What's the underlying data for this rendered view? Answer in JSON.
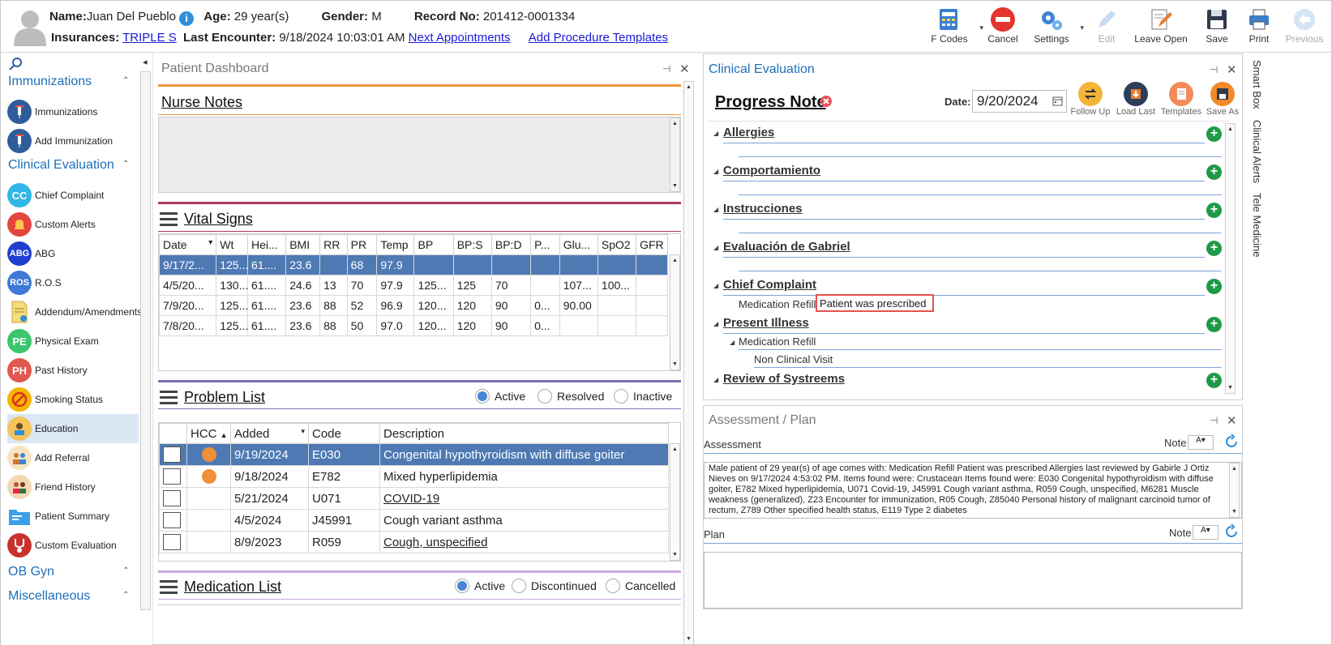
{
  "header": {
    "name_label": "Name:",
    "name_value": "Juan Del Pueblo",
    "info_glyph": "i",
    "age_label": "Age:",
    "age_value": "29 year(s)",
    "gender_label": "Gender:",
    "gender_value": "M",
    "record_label": "Record No:",
    "record_value": "201412-0001334",
    "insurances_label": "Insurances:",
    "insurance_link": "TRIPLE S",
    "last_encounter_label": "Last Encounter:",
    "last_encounter_value": "9/18/2024 10:03:01 AM",
    "next_appointments": "Next Appointments",
    "add_procedure_templates": "Add Procedure Templates"
  },
  "toolbar": {
    "fcodes": "F Codes",
    "cancel": "Cancel",
    "settings": "Settings",
    "edit": "Edit",
    "leave_open": "Leave Open",
    "save": "Save",
    "print": "Print",
    "previous": "Previous",
    "dropdown_glyph": "▾"
  },
  "sidebar": {
    "collapse_glyph": "◂",
    "chevron_up": "⌃",
    "sections": {
      "immunizations": "Immunizations",
      "clinical_evaluation": "Clinical Evaluation",
      "ob_gyn": "OB Gyn",
      "miscellaneous": "Miscellaneous"
    },
    "items": {
      "immunizations": "Immunizations",
      "add_immunization": "Add Immunization",
      "chief_complaint": "Chief Complaint",
      "custom_alerts": "Custom Alerts",
      "abg": "ABG",
      "ros": "R.O.S",
      "addendum": "Addendum/Amendments",
      "physical_exam": "Physical Exam",
      "past_history": "Past History",
      "smoking_status": "Smoking Status",
      "education": "Education",
      "add_referral": "Add Referral",
      "friend_history": "Friend History",
      "patient_summary": "Patient Summary",
      "custom_evaluation": "Custom Evaluation"
    },
    "icon_text": {
      "cc": "CC",
      "abg": "ABG",
      "ros": "ROS",
      "pe": "PE",
      "ph": "PH"
    }
  },
  "dashboard": {
    "title": "Patient Dashboard",
    "pin_glyph": "⊣",
    "close_glyph": "✕",
    "nurse_notes_title": "Nurse Notes",
    "vital_signs_title": "Vital Signs",
    "vitals_columns": [
      "Date",
      "Wt",
      "Hei...",
      "BMI",
      "RR",
      "PR",
      "Temp",
      "BP",
      "BP:S",
      "BP:D",
      "P...",
      "Glu...",
      "SpO2",
      "GFR"
    ],
    "vitals_sort_glyph": "▾",
    "vitals_rows": [
      [
        "9/17/2...",
        "125...",
        "61....",
        "23.6",
        "",
        "68",
        "97.9",
        "",
        "",
        "",
        "",
        "",
        "",
        ""
      ],
      [
        "4/5/20...",
        "130...",
        "61....",
        "24.6",
        "13",
        "70",
        "97.9",
        "125...",
        "125",
        "70",
        "",
        "107...",
        "100...",
        ""
      ],
      [
        "7/9/20...",
        "125...",
        "61....",
        "23.6",
        "88",
        "52",
        "96.9",
        "120...",
        "120",
        "90",
        "0...",
        "90.00",
        "",
        ""
      ],
      [
        "7/8/20...",
        "125...",
        "61....",
        "23.6",
        "88",
        "50",
        "97.0",
        "120...",
        "120",
        "90",
        "0...",
        "",
        "",
        ""
      ]
    ],
    "problem_list_title": "Problem List",
    "problem_filters": {
      "active": "Active",
      "resolved": "Resolved",
      "inactive": "Inactive"
    },
    "problem_columns": {
      "hcc": "HCC",
      "added": "Added",
      "code": "Code",
      "description": "Description"
    },
    "problem_rows": [
      {
        "hcc": true,
        "added": "9/19/2024",
        "code": "E030",
        "description": "Congenital hypothyroidism with diffuse goiter",
        "link": false
      },
      {
        "hcc": true,
        "added": "9/18/2024",
        "code": "E782",
        "description": "Mixed hyperlipidemia",
        "link": false
      },
      {
        "hcc": false,
        "added": "5/21/2024",
        "code": "U071",
        "description": "COVID-19",
        "link": true
      },
      {
        "hcc": false,
        "added": "4/5/2024",
        "code": "J45991",
        "description": "Cough variant asthma",
        "link": false
      },
      {
        "hcc": false,
        "added": "8/9/2023",
        "code": "R059",
        "description": "Cough, unspecified",
        "link": true
      }
    ],
    "medication_list_title": "Medication List",
    "medication_filters": {
      "active": "Active",
      "discontinued": "Discontinued",
      "cancelled": "Cancelled"
    }
  },
  "clinical_evaluation": {
    "title": "Clinical Evaluation",
    "note_title": "Progress Note",
    "date_label": "Date:",
    "date_value": "9/20/2024",
    "actions": {
      "follow_up": "Follow Up",
      "load_last": "Load Last",
      "templates": "Templates",
      "save_as": "Save As"
    },
    "sections": {
      "allergies": "Allergies",
      "comportamiento": "Comportamiento",
      "instrucciones": "Instrucciones",
      "evaluacion": "Evaluación de Gabriel",
      "chief_complaint": "Chief Complaint",
      "present_illness": "Present Illness",
      "review_of_systems": "Review of Systreems"
    },
    "chief_complaint_label": "Medication Refill",
    "chief_complaint_value": "Patient was prescribed",
    "present_illness_item": "Medication Refill",
    "present_illness_sub": "Non Clinical Visit",
    "expand_glyph": "◢",
    "plus_glyph": "+"
  },
  "assessment_plan": {
    "title": "Assessment / Plan",
    "assessment_label": "Assessment",
    "note_label": "Note",
    "assessment_text": "Male patient of 29 year(s) of age comes with: Medication Refill Patient was prescribed     Allergies last reviewed by Gabirle J Ortiz Nieves on 9/17/2024 4:53:02 PM.    Items found were:  Crustacean  Items found were:  E030 Congenital hypothyroidism with diffuse goiter, E782 Mixed hyperlipidemia, U071 Covid-19, J45991 Cough variant asthma, R059 Cough, unspecified, M6281 Muscle weakness (generalized), Z23 Encounter for immunization, R05 Cough, Z85040 Personal history of malignant carcinoid tumor of rectum, Z789 Other specified health status, E119 Type 2 diabetes",
    "plan_label": "Plan"
  },
  "right_tabs": {
    "smart_box": "Smart Box",
    "clinical_alerts": "Clinical Alerts",
    "tele_medicine": "Tele Medicine"
  },
  "colors": {
    "accent_blue": "#1f6fb8",
    "orange_divider": "#f0953c",
    "maroon_divider": "#a83a5a",
    "purple_divider": "#7b6fb3",
    "lilac_divider": "#c7a8e0",
    "selected_row": "#4e79b3",
    "plus_green": "#1f9a48",
    "hcc_orange": "#f0913a"
  }
}
